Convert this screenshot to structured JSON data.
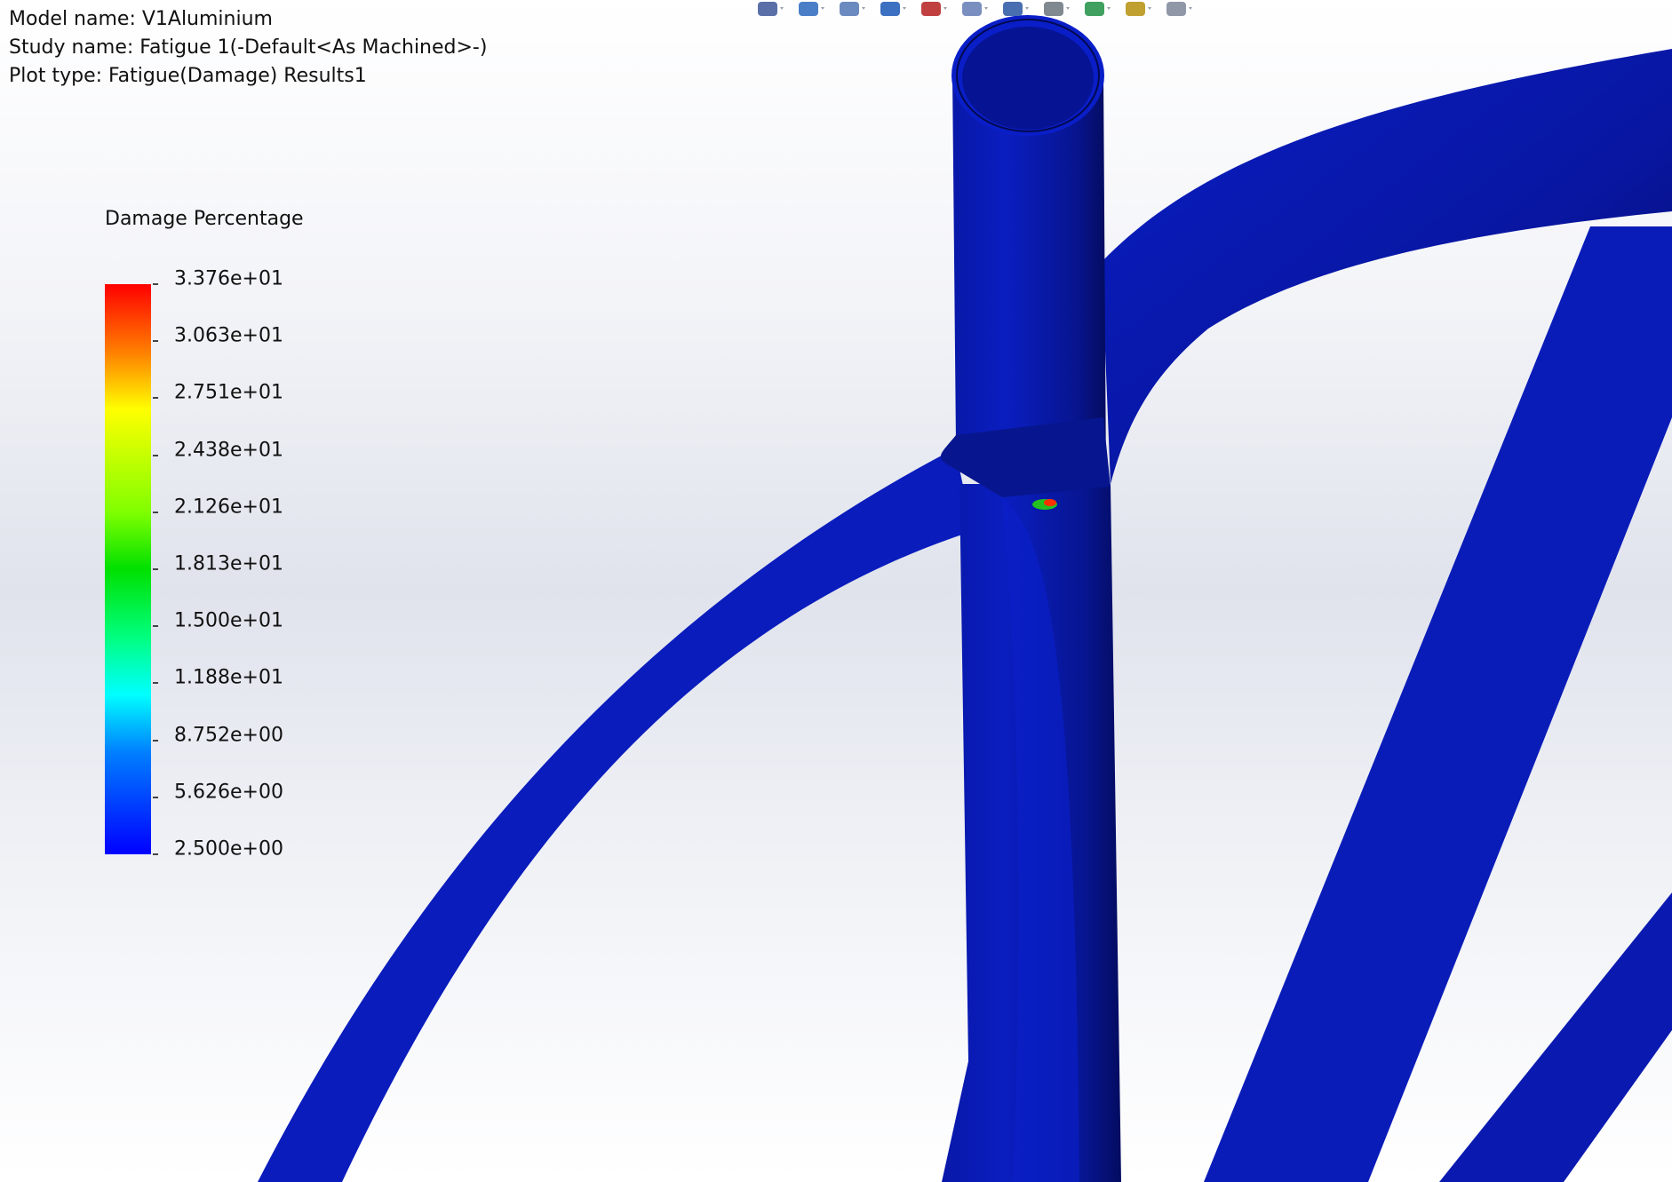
{
  "info": {
    "model_name": "Model name: V1Aluminium",
    "study_name": "Study name: Fatigue 1(-Default<As Machined>-)",
    "plot_type": "Plot type: Fatigue(Damage) Results1"
  },
  "legend": {
    "title": "Damage Percentage",
    "labels": [
      "3.376e+01",
      "3.063e+01",
      "2.751e+01",
      "2.438e+01",
      "2.126e+01",
      "1.813e+01",
      "1.500e+01",
      "1.188e+01",
      "8.752e+00",
      "5.626e+00",
      "2.500e+00"
    ]
  },
  "toolbar": {
    "icons": [
      "zoom-to-fit-icon",
      "zoom-area-icon",
      "previous-view-icon",
      "section-view-icon",
      "dynamic-annotation-icon",
      "view-orientation-icon",
      "display-style-icon",
      "hide-show-items-icon",
      "edit-appearance-icon",
      "apply-scene-icon",
      "view-settings-icon"
    ]
  },
  "colors": {
    "frame": "#0a14b8",
    "frame_dark": "#050a78",
    "hotspot": "#ff3000"
  }
}
